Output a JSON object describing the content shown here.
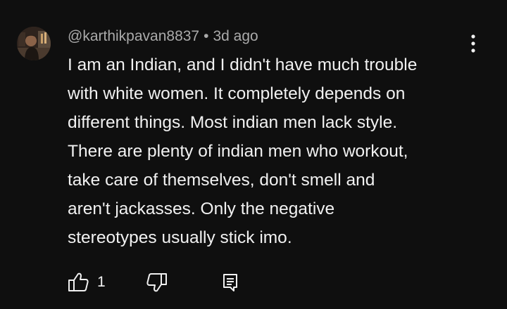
{
  "comment": {
    "author": "@karthikpavan8837",
    "separator": "•",
    "time": "3d ago",
    "text": "I am an Indian, and I didn't have much trouble\nwith white women. It completely depends on\ndifferent things. Most indian men lack style.\nThere are plenty of indian men who workout,\ntake care of themselves, don't smell and\naren't jackasses. Only the negative\nstereotypes usually stick imo.",
    "like_count": "1"
  },
  "icons": {
    "avatar": "avatar-photo",
    "menu": "more-vert-icon",
    "like": "thumb-up-icon",
    "dislike": "thumb-down-icon",
    "reply": "reply-comment-icon"
  },
  "colors": {
    "background": "#0f0f0f",
    "text_primary": "#f1f1f1",
    "text_secondary": "#aaaaaa"
  }
}
